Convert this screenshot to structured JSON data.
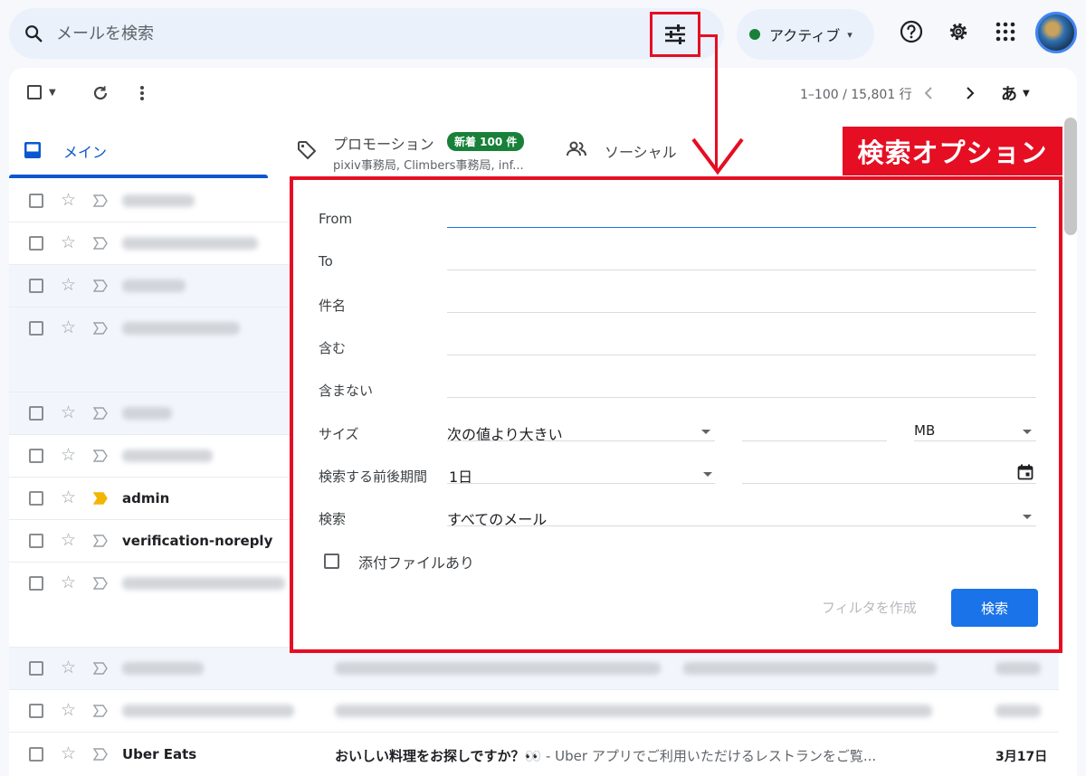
{
  "search": {
    "placeholder": "メールを検索"
  },
  "status": {
    "label": "アクティブ"
  },
  "toolbar": {
    "pager": "1–100 / 15,801 行",
    "lang": "あ"
  },
  "tabs": {
    "main": {
      "label": "メイン"
    },
    "promo": {
      "label": "プロモーション",
      "badge": "新着 100 件",
      "sub": "pixiv事務局, Climbers事務局, inf..."
    },
    "social": {
      "label": "ソーシャル"
    }
  },
  "rows": {
    "admin": {
      "sender": "admin"
    },
    "verification": {
      "sender": "verification-noreply"
    },
    "ubereats": {
      "sender": "Uber Eats",
      "subject": "おいしい料理をお探しですか？👀",
      "snippet": " - Uber アプリでご利用いただけるレストランをご覧...",
      "date": "3月17日"
    }
  },
  "callout": {
    "title": "検索オプション"
  },
  "dialog": {
    "from_label": "From",
    "to_label": "To",
    "subject_label": "件名",
    "has_words_label": "含む",
    "no_words_label": "含まない",
    "size_label": "サイズ",
    "size_op": "次の値より大きい",
    "size_unit": "MB",
    "date_label": "検索する前後期間",
    "date_range": "1日",
    "scope_label": "検索",
    "scope_value": "すべてのメール",
    "attachment_label": "添付ファイルあり",
    "create_filter": "フィルタを作成",
    "search_button": "検索"
  },
  "colors": {
    "accent": "#0b57d0",
    "callout": "#e50e23",
    "button": "#1a73e8",
    "badge": "#188038"
  }
}
